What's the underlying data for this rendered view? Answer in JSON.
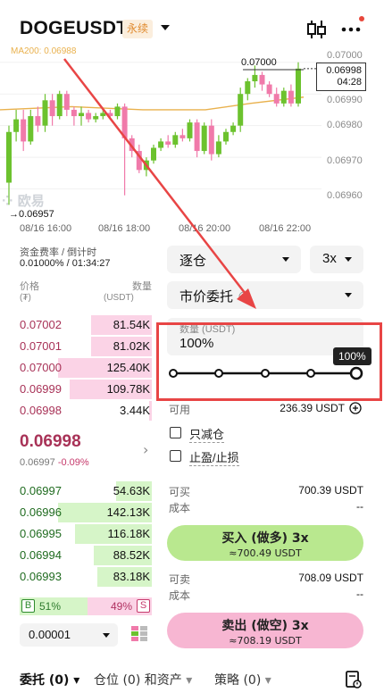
{
  "header": {
    "pair": "DOGEUSDT",
    "contract_type": "永续"
  },
  "chart": {
    "ma_label": "MA200: 0.06988",
    "y_ticks": [
      "0.07000",
      "0.06990",
      "0.06980",
      "0.06970",
      "0.06960"
    ],
    "x_ticks": [
      "08/16 16:00",
      "08/16 18:00",
      "08/16 20:00",
      "08/16 22:00"
    ],
    "high_marker": "0.07000",
    "low_marker": "0.06957",
    "current_price": "0.06998",
    "countdown": "04:28",
    "watermark": "欧易",
    "up_color": "#6cc22e",
    "down_color": "#f07aaa",
    "ma_color": "#e9b14d"
  },
  "funding": {
    "label": "资金费率 / 倒计时",
    "value": "0.01000% / 01:34:27"
  },
  "orderbook": {
    "price_header": "价格",
    "price_unit": "(₮)",
    "qty_header": "数量",
    "qty_unit": "(USDT)",
    "asks": [
      {
        "price": "0.07002",
        "qty": "81.54K",
        "depth": 0.65
      },
      {
        "price": "0.07001",
        "qty": "81.02K",
        "depth": 0.65
      },
      {
        "price": "0.07000",
        "qty": "125.40K",
        "depth": 1.0
      },
      {
        "price": "0.06999",
        "qty": "109.78K",
        "depth": 0.88
      },
      {
        "price": "0.06998",
        "qty": "3.44K",
        "depth": 0.03
      }
    ],
    "last_price": "0.06998",
    "mark_price": "0.06997",
    "change": "-0.09%",
    "bids": [
      {
        "price": "0.06997",
        "qty": "54.63K",
        "depth": 0.38
      },
      {
        "price": "0.06996",
        "qty": "142.13K",
        "depth": 1.0
      },
      {
        "price": "0.06995",
        "qty": "116.18K",
        "depth": 0.82
      },
      {
        "price": "0.06994",
        "qty": "88.52K",
        "depth": 0.62
      },
      {
        "price": "0.06993",
        "qty": "83.18K",
        "depth": 0.58
      }
    ],
    "buy_label": "B",
    "buy_ratio": "51%",
    "sell_ratio": "49%",
    "sell_label": "S",
    "precision": "0.00001"
  },
  "order_form": {
    "margin_mode": "逐仓",
    "leverage": "3x",
    "order_type": "市价委托",
    "qty_label": "数量 (USDT)",
    "qty_value": "100%",
    "slider_pct": 100,
    "slider_tip": "100%",
    "available_label": "可用",
    "available_value": "236.39 USDT",
    "reduce_only": "只减仓",
    "tp_sl": "止盈/止损",
    "can_buy_label": "可买",
    "can_buy_value": "700.39 USDT",
    "cost_label_buy": "成本",
    "cost_value_buy": "--",
    "buy_button": "买入 (做多) 3x",
    "buy_button_sub": "≈700.49 USDT",
    "can_sell_label": "可卖",
    "can_sell_value": "708.09 USDT",
    "cost_label_sell": "成本",
    "cost_value_sell": "--",
    "sell_button": "卖出 (做空) 3x",
    "sell_button_sub": "≈708.19 USDT"
  },
  "bottom_tabs": {
    "orders": "委托 (0)",
    "positions": "仓位 (0) 和资产",
    "strategy": "策略 (0)"
  },
  "icons": {
    "dropdown": "chevron-down-icon",
    "chart_toggle": "candlestick-icon",
    "more": "more-icon",
    "info": "info-icon",
    "plus": "plus-circle-icon",
    "layout": "orderbook-layout-icon",
    "history": "history-icon"
  }
}
